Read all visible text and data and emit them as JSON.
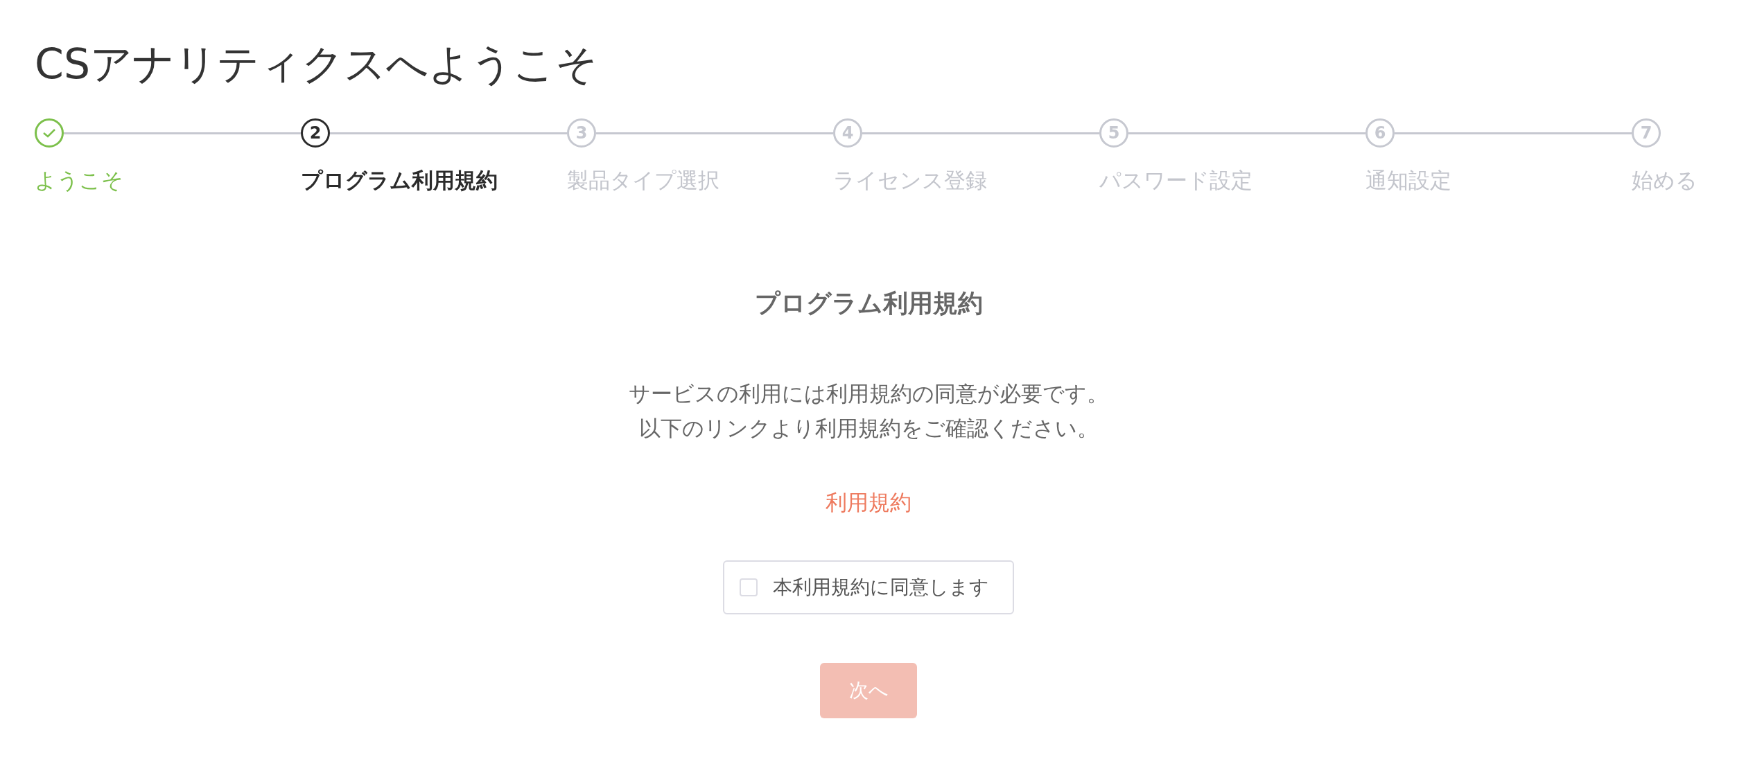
{
  "page_title": "CSアナリティクスへようこそ",
  "steps": [
    {
      "label": "ようこそ",
      "completed": true,
      "selected": false
    },
    {
      "number": "2",
      "label": "プログラム利用規約",
      "completed": false,
      "selected": true
    },
    {
      "number": "3",
      "label": "製品タイプ選択",
      "completed": false,
      "selected": false
    },
    {
      "number": "4",
      "label": "ライセンス登録",
      "completed": false,
      "selected": false
    },
    {
      "number": "5",
      "label": "パスワード設定",
      "completed": false,
      "selected": false
    },
    {
      "number": "6",
      "label": "通知設定",
      "completed": false,
      "selected": false
    },
    {
      "number": "7",
      "label": "始める",
      "completed": false,
      "selected": false
    }
  ],
  "content": {
    "heading": "プログラム利用規約",
    "description_lines": [
      "サービスの利用には利用規約の同意が必要です。",
      "以下のリンクより利用規約をご確認ください。"
    ],
    "link": "利用規約",
    "agreement": {
      "label": "本利用規約に同意します",
      "checked": false
    },
    "next_button": {
      "label": "次へ",
      "disabled": true
    }
  }
}
